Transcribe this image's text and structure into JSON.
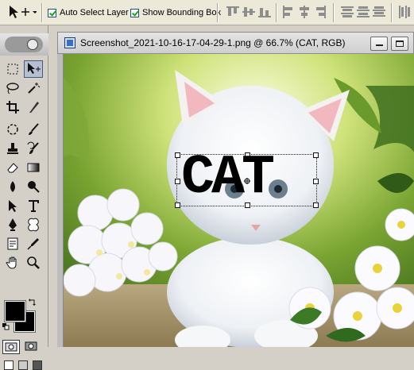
{
  "options_bar": {
    "tool_icon": "move-tool-icon",
    "auto_select_label": "Auto Select Layer",
    "show_bbox_label": "Show Bounding Box"
  },
  "document": {
    "title": "Screenshot_2021-10-16-17-04-29-1.png @ 66.7% (CAT, RGB)",
    "text_layer": "CAT"
  },
  "colors": {
    "foreground": "#000000",
    "background": "#000000"
  }
}
